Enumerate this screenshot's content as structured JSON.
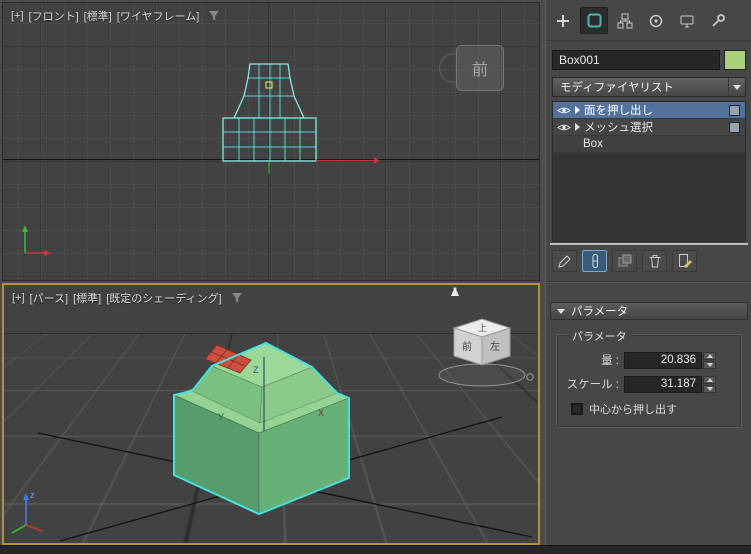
{
  "viewports": {
    "front": {
      "segments": [
        "[+]",
        "[フロント]",
        "[標準]",
        "[ワイヤフレーム]"
      ],
      "viewcube_label": "前"
    },
    "perspective": {
      "segments": [
        "[+]",
        "[パース]",
        "[標準]",
        "[既定のシェーディング]"
      ],
      "viewcube": {
        "top": "上",
        "front": "前",
        "left": "左"
      },
      "axis_labels": {
        "x": "X",
        "y": "Y",
        "z": "Z"
      },
      "tripod_z": "z"
    }
  },
  "panel": {
    "object_name": "Box001",
    "object_color": "#a9d17e",
    "modifier_list_label": "モディファイヤリスト",
    "stack": [
      {
        "label": "面を押し出し"
      },
      {
        "label": "メッシュ選択"
      },
      {
        "label": "Box"
      }
    ],
    "rollout_title": "パラメータ",
    "group_title": "パラメータ",
    "amount_label": "量 :",
    "amount_value": "20.836",
    "scale_label": "スケール :",
    "scale_value": "31.187",
    "checkbox_label": "中心から押し出す"
  },
  "colors": {
    "selection_highlight": "#54719c",
    "active_viewport_border": "#b3913f",
    "wireframe_cyan": "#7fe3e3",
    "object_green": "#8ccd8c",
    "selected_faces_red": "#cb4f41"
  }
}
